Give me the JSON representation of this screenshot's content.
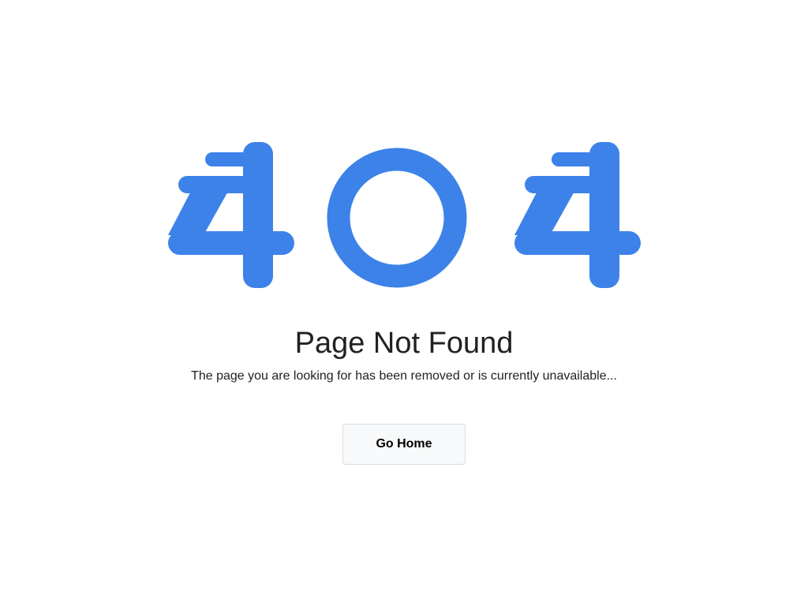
{
  "error_graphic": {
    "digits": [
      "4",
      "0",
      "4"
    ],
    "color": "#3d82e8",
    "icons": [
      "four-digit-icon",
      "zero-digit-icon",
      "four-digit-icon"
    ]
  },
  "heading": "Page Not Found",
  "message": "The page you are looking for has been removed or is currently unavailable...",
  "actions": {
    "home_label": "Go Home"
  }
}
